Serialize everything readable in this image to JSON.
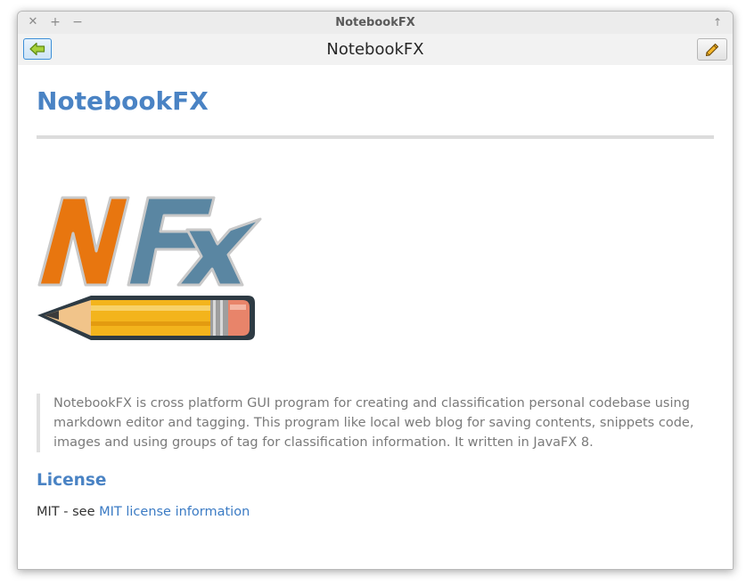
{
  "window": {
    "title": "NotebookFX",
    "controls": {
      "close_glyph": "✕",
      "maximize_glyph": "+",
      "minimize_glyph": "−",
      "pin_glyph": "↑"
    }
  },
  "toolbar": {
    "title": "NotebookFX",
    "back_icon": "back-arrow-icon",
    "edit_icon": "pencil-icon"
  },
  "document": {
    "title": "NotebookFX",
    "logo": {
      "icon": "nfx-pencil-logo",
      "text": "NFx"
    },
    "description": "NotebookFX is cross platform GUI program for creating and classification personal codebase using markdown editor and tagging. This program like local web blog for saving contents, snippets code, images and using groups of tag for classification information. It written in JavaFX 8.",
    "license": {
      "heading": "License",
      "prefix": "MIT - see ",
      "link_text": "MIT license information"
    }
  },
  "colors": {
    "heading": "#4a83c4",
    "link": "#3b7bc4",
    "logo_orange": "#e8760f",
    "logo_blue": "#5a86a2"
  }
}
